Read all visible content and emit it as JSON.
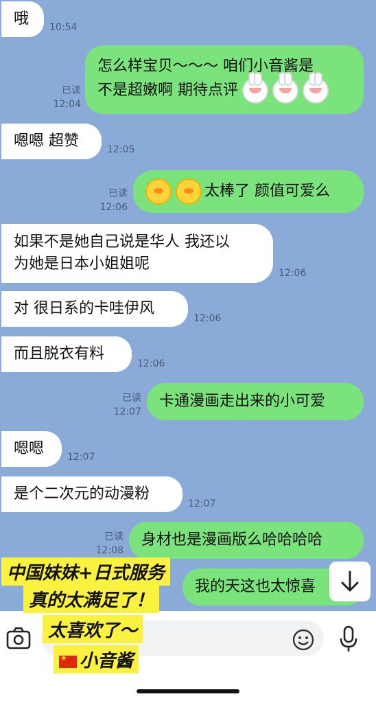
{
  "messages": [
    {
      "text": "哦",
      "time": "10:54",
      "read": ""
    },
    {
      "text": "怎么样宝贝～～～ 咱们小音酱是",
      "text2": "不是超嫩啊 期待点评",
      "time": "12:04",
      "read": "已读"
    },
    {
      "text": "嗯嗯 超赞",
      "time": "12:05",
      "read": ""
    },
    {
      "text": "太棒了 颜值可爱么",
      "time": "12:06",
      "read": "已读"
    },
    {
      "text": "如果不是她自己说是华人 我还以",
      "text2": "为她是日本小姐姐呢",
      "time": "12:06",
      "read": ""
    },
    {
      "text": "对 很日系的卡哇伊风",
      "time": "12:06",
      "read": ""
    },
    {
      "text": "而且脱衣有料",
      "time": "12:06",
      "read": ""
    },
    {
      "text": "卡通漫画走出来的小可爱",
      "time": "12:07",
      "read": "已读"
    },
    {
      "text": "嗯嗯",
      "time": "12:07",
      "read": ""
    },
    {
      "text": "是个二次元的动漫粉",
      "time": "12:07",
      "read": ""
    },
    {
      "text": "身材也是漫画版么哈哈哈哈",
      "time": "12:08",
      "read": "已读"
    },
    {
      "text": "我的天这也太惊喜",
      "time": "",
      "read": ""
    }
  ],
  "icons": {
    "bunny": "bunny-sticker-icon",
    "chick": "chick-sticker-icon",
    "camera": "camera-icon",
    "emoji": "emoji-face-icon",
    "mic": "microphone-icon",
    "scroll": "arrow-down-icon",
    "flag": "china-flag-icon"
  },
  "promo": {
    "line1": "中国妹妹+日式服务",
    "line2": "真的太满足了！",
    "line3": "太喜欢了～",
    "line4": "小音酱"
  },
  "colors": {
    "chat_bg": "#8aaad8",
    "outgoing": "#7be37b",
    "incoming": "#ffffff",
    "promo_bg": "#fbf23f"
  }
}
